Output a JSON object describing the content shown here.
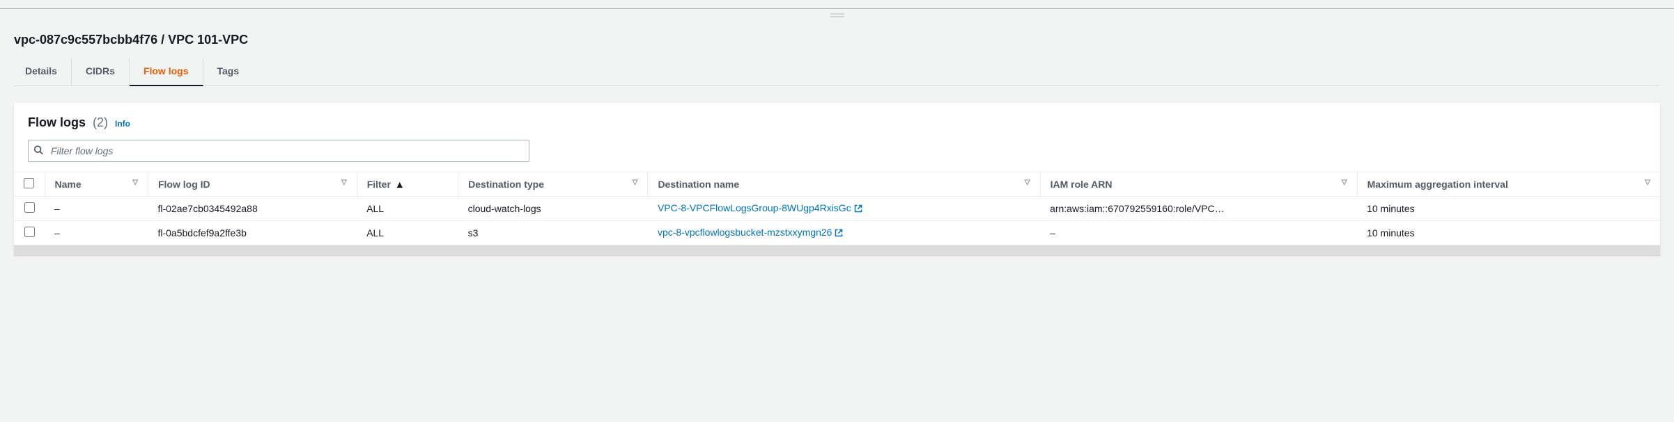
{
  "breadcrumb": "vpc-087c9c557bcbb4f76 / VPC 101-VPC",
  "tabs": [
    {
      "label": "Details",
      "active": false
    },
    {
      "label": "CIDRs",
      "active": false
    },
    {
      "label": "Flow logs",
      "active": true
    },
    {
      "label": "Tags",
      "active": false
    }
  ],
  "panel": {
    "title": "Flow logs",
    "count": "(2)",
    "info": "Info"
  },
  "search": {
    "placeholder": "Filter flow logs"
  },
  "columns": [
    {
      "label": "Name",
      "sort": null,
      "filter": true
    },
    {
      "label": "Flow log ID",
      "sort": null,
      "filter": true
    },
    {
      "label": "Filter",
      "sort": "asc",
      "filter": false
    },
    {
      "label": "Destination type",
      "sort": null,
      "filter": true
    },
    {
      "label": "Destination name",
      "sort": null,
      "filter": true
    },
    {
      "label": "IAM role ARN",
      "sort": null,
      "filter": true
    },
    {
      "label": "Maximum aggregation interval",
      "sort": null,
      "filter": true
    }
  ],
  "rows": [
    {
      "name": "–",
      "flow_log_id": "fl-02ae7cb0345492a88",
      "filter": "ALL",
      "dest_type": "cloud-watch-logs",
      "dest_name": "VPC-8-VPCFlowLogsGroup-8WUgp4RxisGc",
      "dest_link": true,
      "iam_role": "arn:aws:iam::670792559160:role/VPC…",
      "max_agg": "10 minutes"
    },
    {
      "name": "–",
      "flow_log_id": "fl-0a5bdcfef9a2ffe3b",
      "filter": "ALL",
      "dest_type": "s3",
      "dest_name": "vpc-8-vpcflowlogsbucket-mzstxxymgn26",
      "dest_link": true,
      "iam_role": "–",
      "max_agg": "10 minutes"
    }
  ]
}
